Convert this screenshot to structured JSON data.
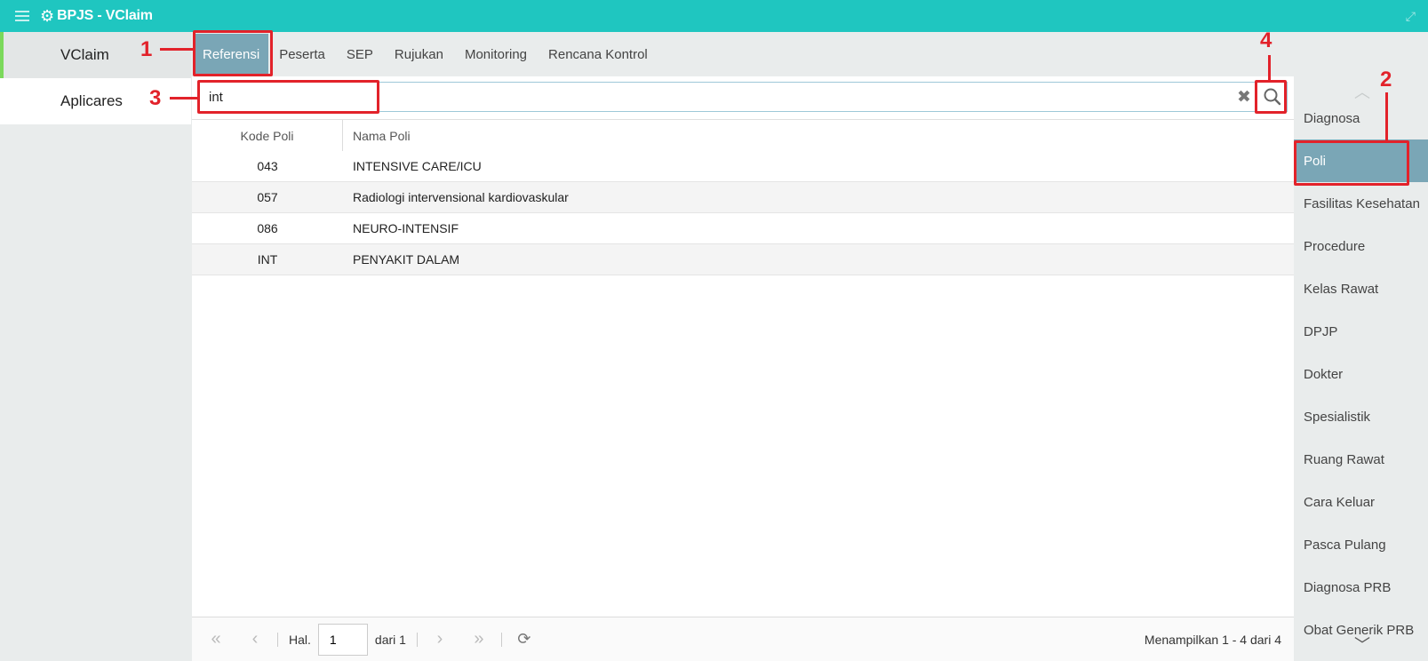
{
  "window": {
    "title": "BPJS - VClaim"
  },
  "leftnav": {
    "items": [
      {
        "label": "VClaim"
      },
      {
        "label": "Aplicares"
      }
    ]
  },
  "topmenu": {
    "tabs": [
      {
        "label": "Referensi"
      },
      {
        "label": "Peserta"
      },
      {
        "label": "SEP"
      },
      {
        "label": "Rujukan"
      },
      {
        "label": "Monitoring"
      },
      {
        "label": "Rencana Kontrol"
      }
    ]
  },
  "search": {
    "value": "int"
  },
  "table": {
    "headers": {
      "kode": "Kode Poli",
      "nama": "Nama Poli"
    },
    "rows": [
      {
        "kode": "043",
        "nama": "INTENSIVE CARE/ICU"
      },
      {
        "kode": "057",
        "nama": "Radiologi intervensional kardiovaskular"
      },
      {
        "kode": "086",
        "nama": "NEURO-INTENSIF"
      },
      {
        "kode": "INT",
        "nama": "PENYAKIT DALAM"
      }
    ]
  },
  "pager": {
    "hal_label": "Hal.",
    "page_value": "1",
    "dari_label": "dari 1",
    "info": "Menampilkan 1 - 4 dari 4"
  },
  "rightnav": {
    "items": [
      {
        "label": "Diagnosa"
      },
      {
        "label": "Poli"
      },
      {
        "label": "Fasilitas Kesehatan"
      },
      {
        "label": "Procedure"
      },
      {
        "label": "Kelas Rawat"
      },
      {
        "label": "DPJP"
      },
      {
        "label": "Dokter"
      },
      {
        "label": "Spesialistik"
      },
      {
        "label": "Ruang Rawat"
      },
      {
        "label": "Cara Keluar"
      },
      {
        "label": "Pasca Pulang"
      },
      {
        "label": "Diagnosa PRB"
      },
      {
        "label": "Obat Generik PRB"
      }
    ]
  },
  "annotations": {
    "n1": "1",
    "n2": "2",
    "n3": "3",
    "n4": "4"
  },
  "colors": {
    "header": "#1fc6c0",
    "active_tab": "#7aa6b6",
    "annotation": "#e2222a",
    "active_left_marker": "#7bd95b"
  }
}
